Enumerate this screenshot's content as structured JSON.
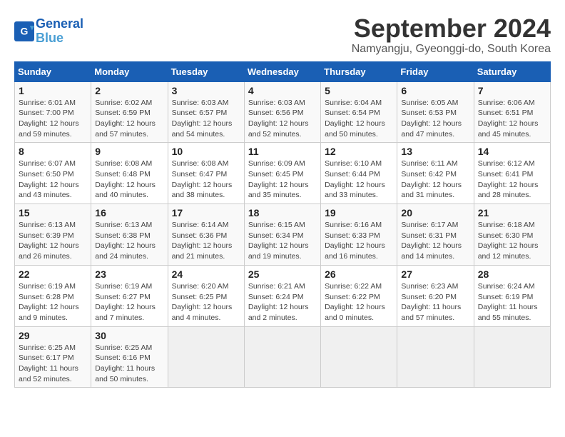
{
  "header": {
    "logo_line1": "General",
    "logo_line2": "Blue",
    "month_year": "September 2024",
    "location": "Namyangju, Gyeonggi-do, South Korea"
  },
  "days_of_week": [
    "Sunday",
    "Monday",
    "Tuesday",
    "Wednesday",
    "Thursday",
    "Friday",
    "Saturday"
  ],
  "weeks": [
    [
      {
        "day": "1",
        "info": "Sunrise: 6:01 AM\nSunset: 7:00 PM\nDaylight: 12 hours\nand 59 minutes."
      },
      {
        "day": "2",
        "info": "Sunrise: 6:02 AM\nSunset: 6:59 PM\nDaylight: 12 hours\nand 57 minutes."
      },
      {
        "day": "3",
        "info": "Sunrise: 6:03 AM\nSunset: 6:57 PM\nDaylight: 12 hours\nand 54 minutes."
      },
      {
        "day": "4",
        "info": "Sunrise: 6:03 AM\nSunset: 6:56 PM\nDaylight: 12 hours\nand 52 minutes."
      },
      {
        "day": "5",
        "info": "Sunrise: 6:04 AM\nSunset: 6:54 PM\nDaylight: 12 hours\nand 50 minutes."
      },
      {
        "day": "6",
        "info": "Sunrise: 6:05 AM\nSunset: 6:53 PM\nDaylight: 12 hours\nand 47 minutes."
      },
      {
        "day": "7",
        "info": "Sunrise: 6:06 AM\nSunset: 6:51 PM\nDaylight: 12 hours\nand 45 minutes."
      }
    ],
    [
      {
        "day": "8",
        "info": "Sunrise: 6:07 AM\nSunset: 6:50 PM\nDaylight: 12 hours\nand 43 minutes."
      },
      {
        "day": "9",
        "info": "Sunrise: 6:08 AM\nSunset: 6:48 PM\nDaylight: 12 hours\nand 40 minutes."
      },
      {
        "day": "10",
        "info": "Sunrise: 6:08 AM\nSunset: 6:47 PM\nDaylight: 12 hours\nand 38 minutes."
      },
      {
        "day": "11",
        "info": "Sunrise: 6:09 AM\nSunset: 6:45 PM\nDaylight: 12 hours\nand 35 minutes."
      },
      {
        "day": "12",
        "info": "Sunrise: 6:10 AM\nSunset: 6:44 PM\nDaylight: 12 hours\nand 33 minutes."
      },
      {
        "day": "13",
        "info": "Sunrise: 6:11 AM\nSunset: 6:42 PM\nDaylight: 12 hours\nand 31 minutes."
      },
      {
        "day": "14",
        "info": "Sunrise: 6:12 AM\nSunset: 6:41 PM\nDaylight: 12 hours\nand 28 minutes."
      }
    ],
    [
      {
        "day": "15",
        "info": "Sunrise: 6:13 AM\nSunset: 6:39 PM\nDaylight: 12 hours\nand 26 minutes."
      },
      {
        "day": "16",
        "info": "Sunrise: 6:13 AM\nSunset: 6:38 PM\nDaylight: 12 hours\nand 24 minutes."
      },
      {
        "day": "17",
        "info": "Sunrise: 6:14 AM\nSunset: 6:36 PM\nDaylight: 12 hours\nand 21 minutes."
      },
      {
        "day": "18",
        "info": "Sunrise: 6:15 AM\nSunset: 6:34 PM\nDaylight: 12 hours\nand 19 minutes."
      },
      {
        "day": "19",
        "info": "Sunrise: 6:16 AM\nSunset: 6:33 PM\nDaylight: 12 hours\nand 16 minutes."
      },
      {
        "day": "20",
        "info": "Sunrise: 6:17 AM\nSunset: 6:31 PM\nDaylight: 12 hours\nand 14 minutes."
      },
      {
        "day": "21",
        "info": "Sunrise: 6:18 AM\nSunset: 6:30 PM\nDaylight: 12 hours\nand 12 minutes."
      }
    ],
    [
      {
        "day": "22",
        "info": "Sunrise: 6:19 AM\nSunset: 6:28 PM\nDaylight: 12 hours\nand 9 minutes."
      },
      {
        "day": "23",
        "info": "Sunrise: 6:19 AM\nSunset: 6:27 PM\nDaylight: 12 hours\nand 7 minutes."
      },
      {
        "day": "24",
        "info": "Sunrise: 6:20 AM\nSunset: 6:25 PM\nDaylight: 12 hours\nand 4 minutes."
      },
      {
        "day": "25",
        "info": "Sunrise: 6:21 AM\nSunset: 6:24 PM\nDaylight: 12 hours\nand 2 minutes."
      },
      {
        "day": "26",
        "info": "Sunrise: 6:22 AM\nSunset: 6:22 PM\nDaylight: 12 hours\nand 0 minutes."
      },
      {
        "day": "27",
        "info": "Sunrise: 6:23 AM\nSunset: 6:20 PM\nDaylight: 11 hours\nand 57 minutes."
      },
      {
        "day": "28",
        "info": "Sunrise: 6:24 AM\nSunset: 6:19 PM\nDaylight: 11 hours\nand 55 minutes."
      }
    ],
    [
      {
        "day": "29",
        "info": "Sunrise: 6:25 AM\nSunset: 6:17 PM\nDaylight: 11 hours\nand 52 minutes."
      },
      {
        "day": "30",
        "info": "Sunrise: 6:25 AM\nSunset: 6:16 PM\nDaylight: 11 hours\nand 50 minutes."
      },
      {
        "day": "",
        "info": ""
      },
      {
        "day": "",
        "info": ""
      },
      {
        "day": "",
        "info": ""
      },
      {
        "day": "",
        "info": ""
      },
      {
        "day": "",
        "info": ""
      }
    ]
  ]
}
